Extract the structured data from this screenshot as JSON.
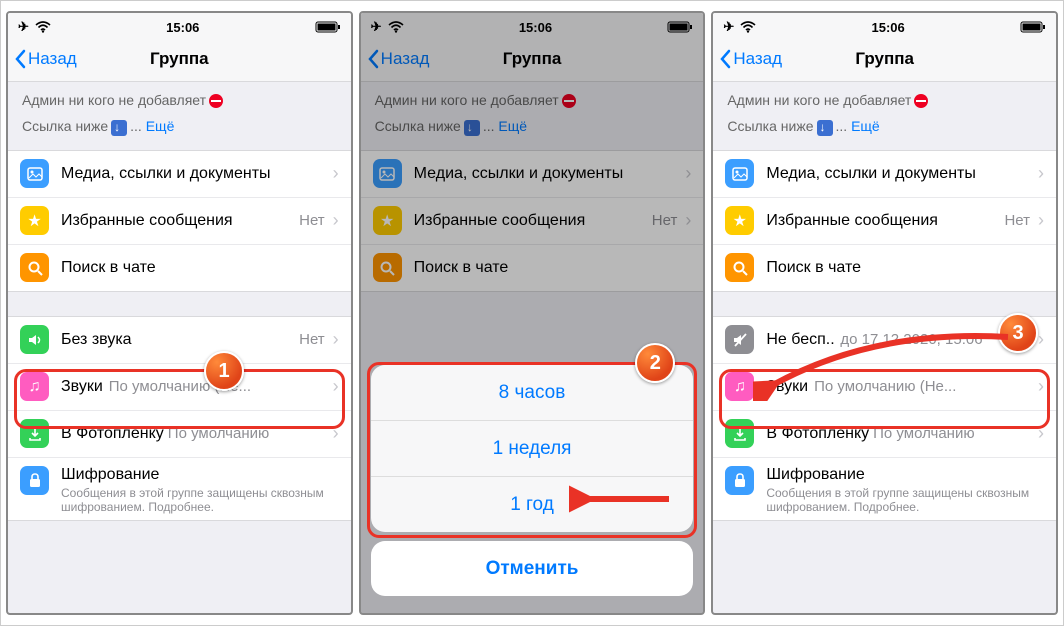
{
  "status": {
    "time": "15:06"
  },
  "nav": {
    "back": "Назад",
    "title": "Группа"
  },
  "info": {
    "l1": "Админ ни кого не добавляет",
    "l2a": "Ссылка ниже",
    "l2b": "...",
    "more": "Ещё"
  },
  "rows": {
    "media": "Медиа, ссылки и документы",
    "starred": "Избранные сообщения",
    "starred_val": "Нет",
    "search": "Поиск в чате",
    "mute": "Без звука",
    "mute_val": "Нет",
    "mute2": "Не бесп...",
    "mute2_val": "до 17.12.2020, 15:06",
    "sounds": "Звуки",
    "sounds_val": "По умолчанию (Не...",
    "save": "В Фотоплёнку",
    "save_val": "По умолчанию",
    "enc": "Шифрование",
    "enc_sub": "Сообщения в этой группе защищены сквозным шифрованием. Подробнее."
  },
  "sheet": {
    "o1": "8 часов",
    "o2": "1 неделя",
    "o3": "1 год",
    "cancel": "Отменить"
  },
  "badge": {
    "b1": "1",
    "b2": "2",
    "b3": "3"
  }
}
